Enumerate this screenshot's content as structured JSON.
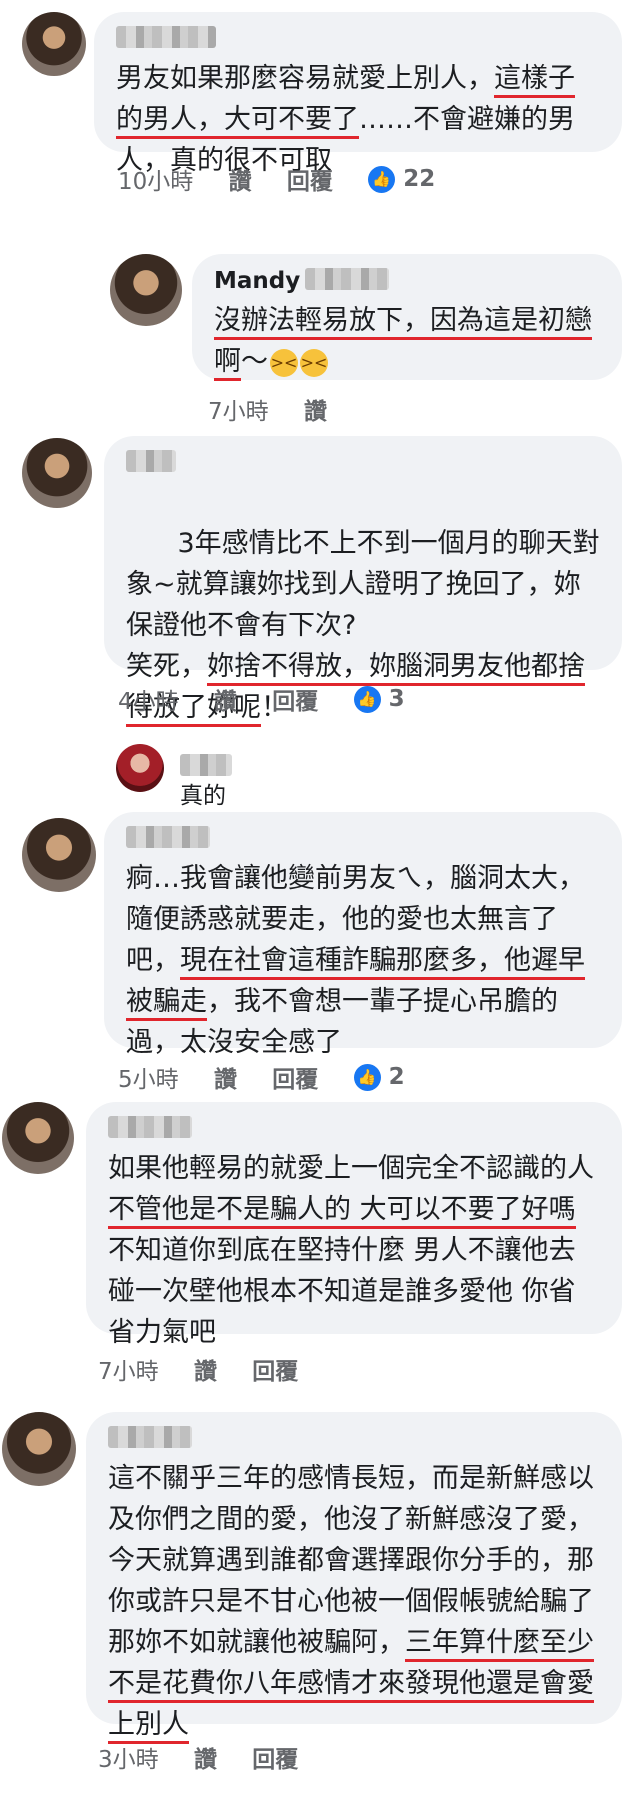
{
  "comments": [
    {
      "name": "",
      "segments": [
        {
          "t": "男友如果那麼容易就愛上別人，",
          "u": false
        },
        {
          "t": "這樣子的男人，大可不要了",
          "u": true
        },
        {
          "t": "……不會避嫌的男人，真的很不可取",
          "u": false
        }
      ],
      "time": "10小時",
      "like": "讚",
      "reply": "回覆",
      "likes": "22"
    },
    {
      "name": "Mandy",
      "segments": [
        {
          "t": "沒辦法輕易放下，因為這是初戀啊",
          "u": true
        },
        {
          "t": "～",
          "u": false
        }
      ],
      "emojis": [
        "tired-face",
        "tired-face"
      ],
      "time": "7小時",
      "like": "讚"
    },
    {
      "name": "",
      "segments": [
        {
          "t": "3年感情比不上不到一個月的聊天對象~就算讓妳找到人證明了挽回了，妳保證他不會有下次?",
          "u": false
        },
        {
          "t": "\n笑死，",
          "u": false
        },
        {
          "t": "妳捨不得放，妳腦洞男友他都捨得放了妳呢",
          "u": true
        },
        {
          "t": "！",
          "u": false
        }
      ],
      "time": "4小時",
      "like": "讚",
      "reply": "回覆",
      "likes": "3"
    },
    {
      "name": "",
      "reply_text": "真的"
    },
    {
      "name": "",
      "segments": [
        {
          "t": "痾…我會讓他變前男友ㄟ，腦洞太大，隨便誘惑就要走，他的愛也太無言了吧，",
          "u": false
        },
        {
          "t": "現在社會這種詐騙那麼多，他遲早被騙走",
          "u": true
        },
        {
          "t": "，我不會想一輩子提心吊膽的過，太沒安全感了",
          "u": false
        }
      ],
      "time": "5小時",
      "like": "讚",
      "reply": "回覆",
      "likes": "2"
    },
    {
      "name": "",
      "segments": [
        {
          "t": "如果他輕易的就愛上一個完全不認識的人 ",
          "u": false
        },
        {
          "t": "不管他是不是騙人的 大可以不要了好嗎",
          "u": true
        },
        {
          "t": " 不知道你到底在堅持什麼 男人不讓他去碰一次壁他根本不知道是誰多愛他 你省省力氣吧",
          "u": false
        }
      ],
      "time": "7小時",
      "like": "讚",
      "reply": "回覆"
    },
    {
      "name": "",
      "segments": [
        {
          "t": "這不關乎三年的感情長短，而是新鮮感以及你們之間的愛，他沒了新鮮感沒了愛，今天就算遇到誰都會選擇跟你分手的，那你或許只是不甘心他被一個假帳號給騙了那妳不如就讓他被騙阿，",
          "u": false
        },
        {
          "t": "三年算什麼至少不是花費你八年感情才來發現他還是會愛上別人",
          "u": true
        }
      ],
      "time": "3小時",
      "like": "讚",
      "reply": "回覆"
    }
  ],
  "icons": {
    "like_reaction": "thumbs-up-icon",
    "emoji": "tired-face-emoji"
  },
  "colors": {
    "bubble": "#f0f2f5",
    "underline": "#e0262d",
    "like_blue": "#1877f2",
    "meta_text": "#65676b"
  }
}
